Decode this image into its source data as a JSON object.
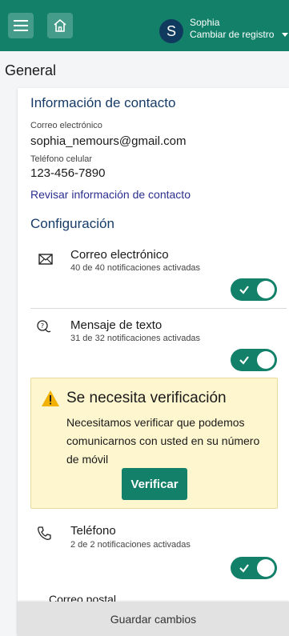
{
  "header": {
    "user_initial": "S",
    "user_name": "Sophia",
    "switch_label": "Cambiar de registro",
    "bg_color": "#138069"
  },
  "section": {
    "title": "General"
  },
  "contact": {
    "title": "Información de contacto",
    "email_label": "Correo electrónico",
    "email_value": "sophia_nemours@gmail.com",
    "phone_label": "Teléfono celular",
    "phone_value": "123-456-7890",
    "review_link": "Revisar información de contacto"
  },
  "config": {
    "title": "Configuración",
    "items": [
      {
        "title": "Correo electrónico",
        "subtitle": "40 de 40 notificaciones activadas",
        "icon": "envelope-icon",
        "enabled": true
      },
      {
        "title": "Mensaje de texto",
        "subtitle": "31 de 32 notificaciones activadas",
        "icon": "chat-bubbles-icon",
        "enabled": true
      },
      {
        "title": "Teléfono",
        "subtitle": "2 de 2 notificaciones activadas",
        "icon": "phone-icon",
        "enabled": true
      },
      {
        "title": "Correo postal",
        "icon": "mail-icon"
      }
    ]
  },
  "alert": {
    "title": "Se necesita verificación",
    "body": "Necesitamos verificar que podemos comunicarnos con usted en su número de móvil",
    "button_label": "Verificar",
    "bg_color": "#fdf6cf"
  },
  "footer": {
    "save_label": "Guardar cambios"
  }
}
